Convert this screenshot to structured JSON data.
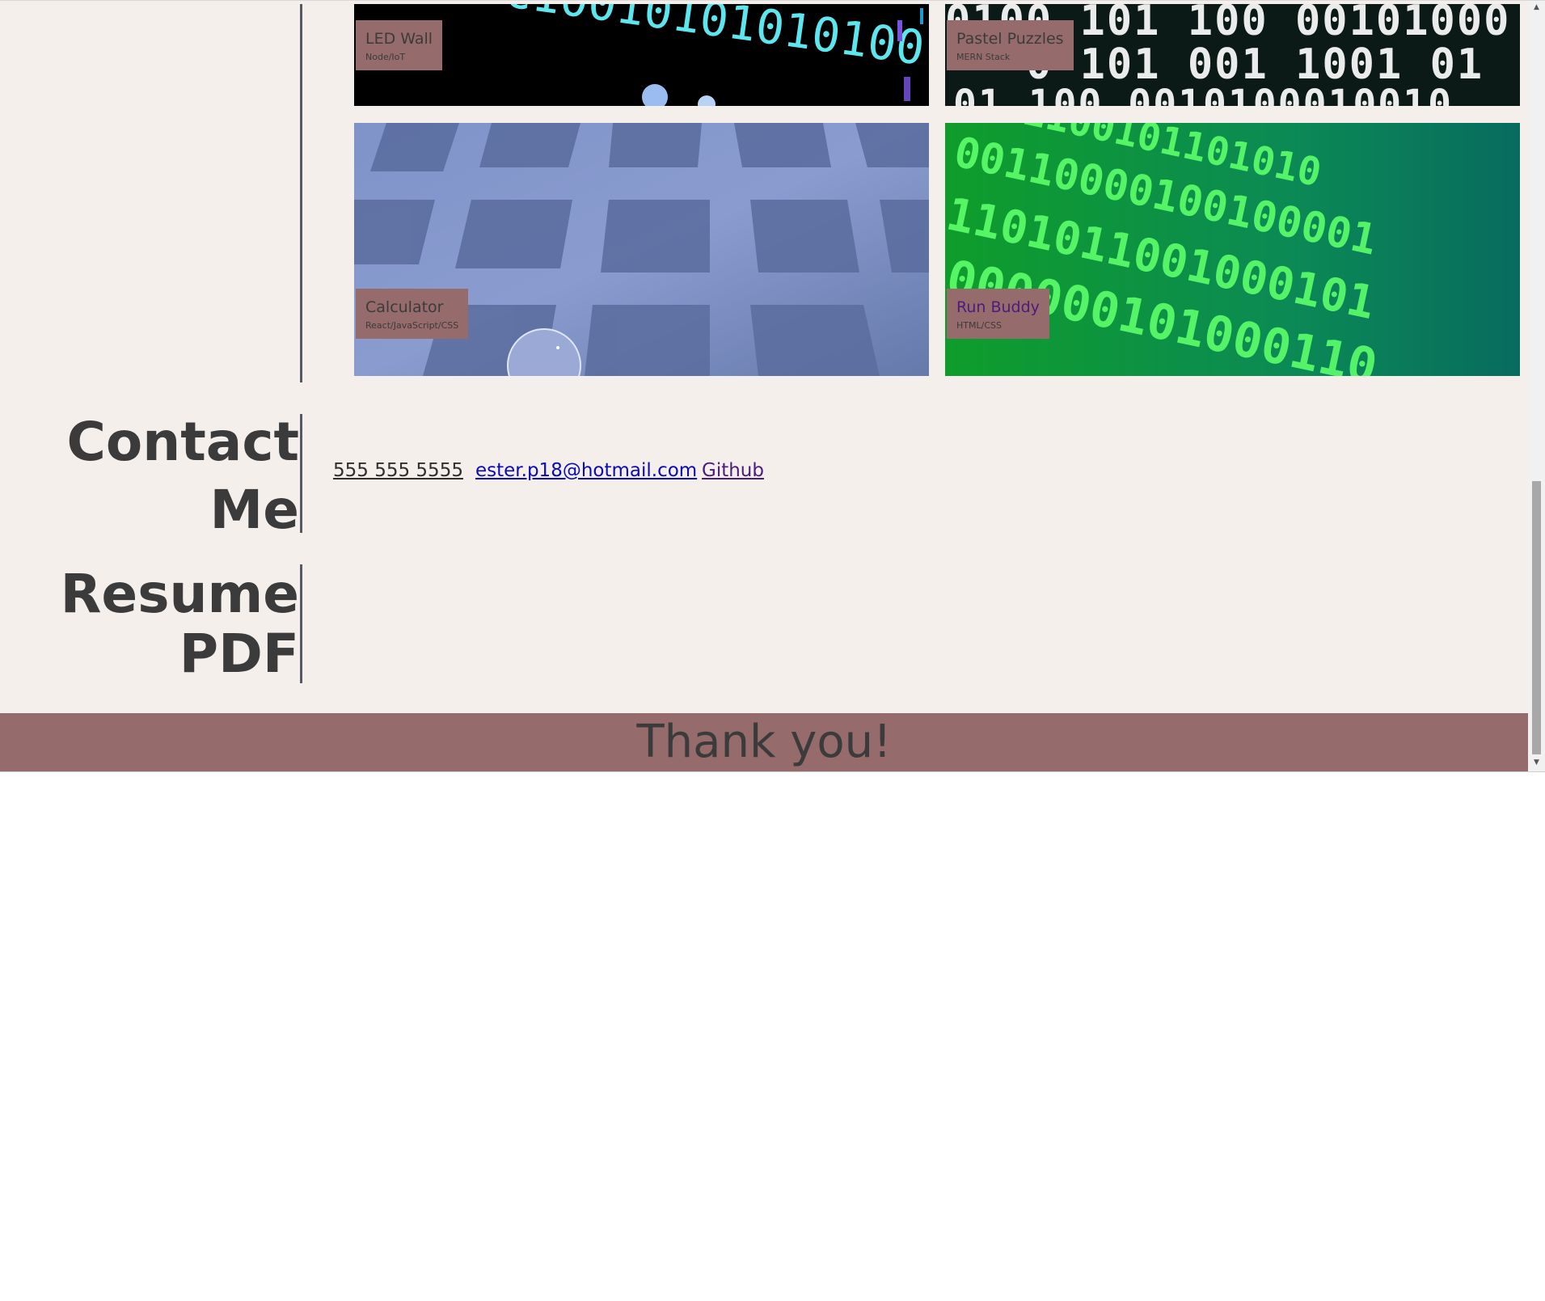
{
  "projects": [
    {
      "title": "LED Wall",
      "stack": "Node/IoT",
      "visited": false
    },
    {
      "title": "Pastel Puzzles",
      "stack": "MERN Stack",
      "visited": false
    },
    {
      "title": "Calculator",
      "stack": "React/JavaScript/CSS",
      "visited": false
    },
    {
      "title": "Run Buddy",
      "stack": "HTML/CSS",
      "visited": true
    }
  ],
  "contact": {
    "heading": "Contact Me",
    "phone": "555 555 5555",
    "email": "ester.p18@hotmail.com",
    "github": "Github"
  },
  "resume": {
    "heading_line1": "Resume",
    "heading_line2": "PDF"
  },
  "footer": {
    "text": "Thank you!"
  },
  "colors": {
    "page_background": "#f5efec",
    "label_background": "#966b6b",
    "divider": "#535a63",
    "heading_text": "#3b3b3b",
    "link": "#0b0bb5",
    "visited_link": "#4a1c7c"
  },
  "scrollbar": {
    "up_arrow_icon": "triangle-up",
    "down_arrow_icon": "triangle-down"
  }
}
